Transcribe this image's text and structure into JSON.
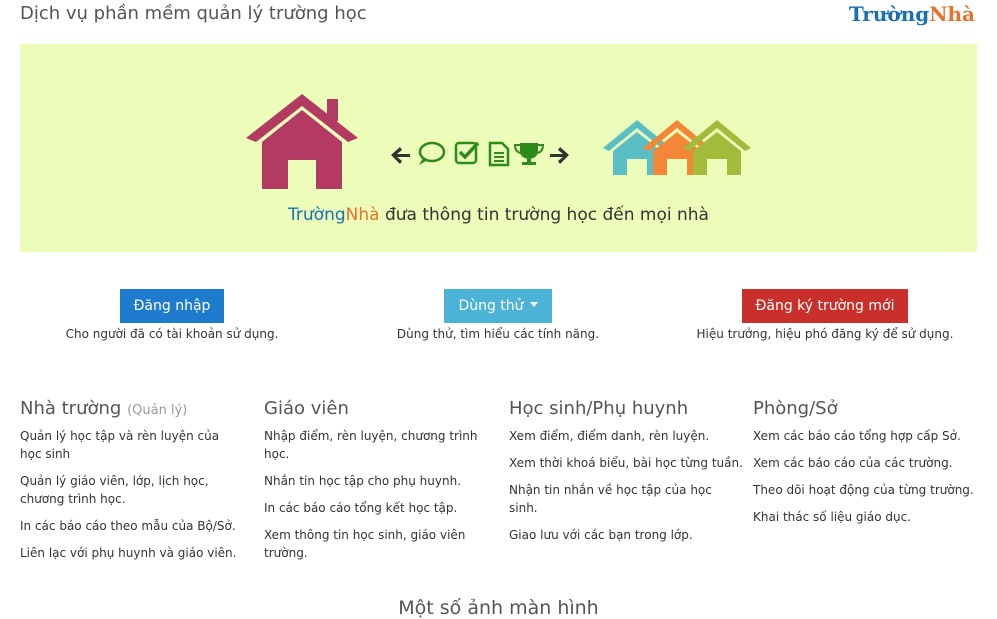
{
  "header": {
    "title": "Dịch vụ phần mềm quản lý trường học",
    "logo_part1": "Trường",
    "logo_part2": "Nhà"
  },
  "hero": {
    "tagline_brand1": "Trường",
    "tagline_brand2": "Nhà",
    "tagline_rest": " đưa thông tin trường học đến mọi nhà",
    "icons": [
      "home-icon",
      "arrow-left-icon",
      "comment-icon",
      "check-square-icon",
      "document-icon",
      "trophy-icon",
      "arrow-right-icon",
      "homes-group-icon"
    ],
    "colors": {
      "background": "#ecfcb9",
      "school_house": "#b33a62",
      "action_icons": "#2e8b1a",
      "house_teal": "#4bb8c7",
      "house_orange": "#f47b2a",
      "house_olive": "#9bb52e"
    }
  },
  "actions": {
    "login": {
      "label": "Đăng nhập",
      "desc": "Cho người đã có tài khoản sử dụng.",
      "color": "#1f7bcd"
    },
    "trial": {
      "label": "Dùng thử",
      "desc": "Dùng thử, tìm hiểu các tính năng.",
      "color": "#4ab3d6"
    },
    "register": {
      "label": "Đăng ký trường mới",
      "desc": "Hiệu trưởng, hiệu phó đăng ký để sử dụng.",
      "color": "#c9302c"
    }
  },
  "features": [
    {
      "title": "Nhà trường",
      "subtitle": "(Quản lý)",
      "items": [
        "Quản lý học tập và rèn luyện của học sinh",
        "Quản lý giáo viên, lớp, lịch học, chương trình học.",
        "In các báo cáo theo mẫu của Bộ/Sở.",
        "Liên lạc với phụ huynh và giáo viên."
      ]
    },
    {
      "title": "Giáo viên",
      "subtitle": "",
      "items": [
        "Nhập điểm, rèn luyện, chương trình học.",
        "Nhắn tin học tập cho phụ huynh.",
        "In các báo cáo tổng kết học tập.",
        "Xem thông tin học sinh, giáo viên trường."
      ]
    },
    {
      "title": "Học sinh/Phụ huynh",
      "subtitle": "",
      "items": [
        "Xem điểm, điểm danh, rèn luyện.",
        "Xem thời khoá biểu, bài học từng tuần.",
        "Nhận tin nhắn về học tập của học sinh.",
        "Giao lưu với các bạn trong lớp."
      ]
    },
    {
      "title": "Phòng/Sở",
      "subtitle": "",
      "items": [
        "Xem các báo cáo tổng hợp cấp Sở.",
        "Xem các báo cáo của các trường.",
        "Theo dõi hoạt động của từng trường.",
        "Khai thác số liệu giáo dục."
      ]
    }
  ],
  "screenshots": {
    "title": "Một số ảnh màn hình"
  }
}
